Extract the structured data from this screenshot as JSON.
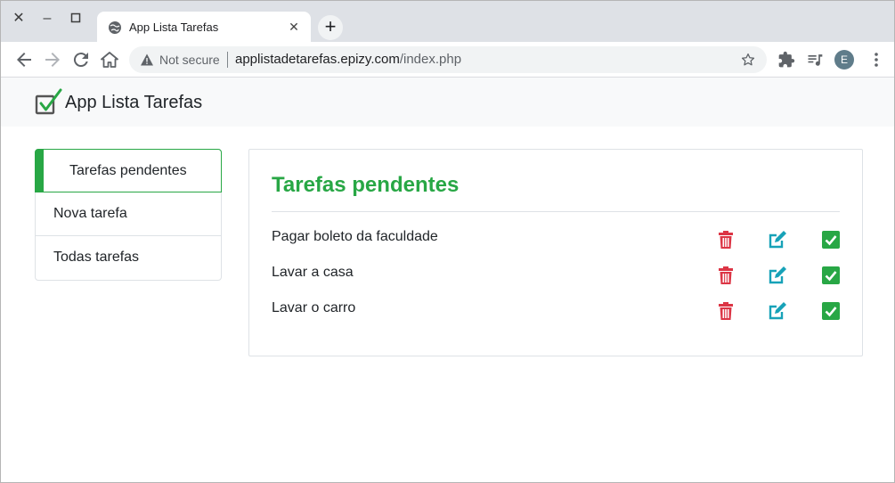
{
  "browser": {
    "tab_title": "App Lista Tarefas",
    "security_label": "Not secure",
    "url_host": "applistadetarefas.epizy.com",
    "url_path": "/index.php",
    "profile_initial": "E"
  },
  "app": {
    "brand": "App Lista Tarefas"
  },
  "sidebar": {
    "items": [
      {
        "label": "Tarefas pendentes",
        "active": true
      },
      {
        "label": "Nova tarefa",
        "active": false
      },
      {
        "label": "Todas tarefas",
        "active": false
      }
    ]
  },
  "panel": {
    "title": "Tarefas pendentes",
    "tasks": [
      {
        "name": "Pagar boleto da faculdade"
      },
      {
        "name": "Lavar a casa"
      },
      {
        "name": "Lavar o carro"
      }
    ]
  },
  "colors": {
    "success": "#28a745",
    "danger": "#dc3545",
    "info": "#17a2b8"
  },
  "icons": {
    "delete": "trash-icon",
    "edit": "edit-icon",
    "done": "check-square-icon"
  }
}
